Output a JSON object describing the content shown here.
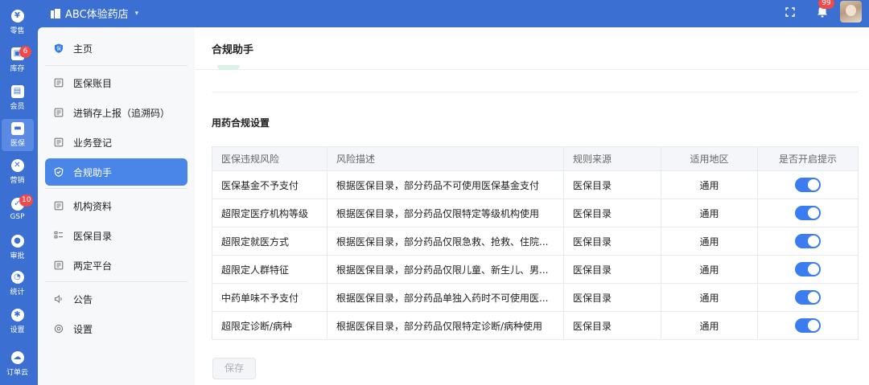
{
  "rail": {
    "items": [
      {
        "label": "零售",
        "glyph": "¥",
        "icon": "yen-icon"
      },
      {
        "label": "库存",
        "glyph": "▣",
        "icon": "inventory-icon",
        "badge": "6"
      },
      {
        "label": "会员",
        "glyph": "▤",
        "icon": "member-card-icon"
      },
      {
        "label": "医保",
        "glyph": "▬",
        "icon": "medical-insurance-icon"
      },
      {
        "label": "营销",
        "glyph": "✕",
        "icon": "marketing-icon"
      },
      {
        "label": "GSP",
        "glyph": "✓",
        "icon": "gsp-shield-icon",
        "badge": "10"
      },
      {
        "label": "审批",
        "glyph": "●",
        "icon": "approval-user-icon"
      },
      {
        "label": "统计",
        "glyph": "◔",
        "icon": "stats-pie-icon"
      },
      {
        "label": "设置",
        "glyph": "✱",
        "icon": "settings-gear-icon"
      },
      {
        "label": "订单云",
        "glyph": "☁",
        "icon": "order-cloud-icon"
      }
    ],
    "active_index": 3
  },
  "topbar": {
    "store_name": "ABC体验药店",
    "notification_badge": "99"
  },
  "sidebar": {
    "items": [
      {
        "label": "主页",
        "icon": "insurance-badge-icon"
      },
      {
        "label": "医保账目",
        "icon": "ledger-icon"
      },
      {
        "label": "进销存上报（追溯码）",
        "icon": "report-doc-icon"
      },
      {
        "label": "业务登记",
        "icon": "register-icon"
      },
      {
        "label": "合规助手",
        "icon": "shield-check-icon"
      },
      {
        "label": "机构资料",
        "icon": "institution-doc-icon"
      },
      {
        "label": "医保目录",
        "icon": "catalog-list-icon"
      },
      {
        "label": "两定平台",
        "icon": "platform-icon"
      },
      {
        "label": "公告",
        "icon": "speaker-icon"
      },
      {
        "label": "设置",
        "icon": "gear-icon"
      }
    ],
    "active_index": 4
  },
  "main": {
    "title": "合规助手",
    "section_title": "用药合规设置",
    "columns": [
      "医保违规风险",
      "风险描述",
      "规则来源",
      "适用地区",
      "是否开启提示"
    ],
    "rows": [
      {
        "risk": "医保基金不予支付",
        "desc": "根据医保目录，部分药品不可使用医保基金支付",
        "source": "医保目录",
        "region": "通用",
        "enabled": true
      },
      {
        "risk": "超限定医疗机构等级",
        "desc": "根据医保目录，部分药品仅限特定等级机构使用",
        "source": "医保目录",
        "region": "通用",
        "enabled": true
      },
      {
        "risk": "超限定就医方式",
        "desc": "根据医保目录，部分药品仅限急救、抢救、住院...",
        "source": "医保目录",
        "region": "通用",
        "enabled": true
      },
      {
        "risk": "超限定人群特征",
        "desc": "根据医保目录，部分药品仅限儿童、新生儿、男...",
        "source": "医保目录",
        "region": "通用",
        "enabled": true
      },
      {
        "risk": "中药单味不予支付",
        "desc": "根据医保目录，部分药品单独入药时不可使用医...",
        "source": "医保目录",
        "region": "通用",
        "enabled": true
      },
      {
        "risk": "超限定诊断/病种",
        "desc": "根据医保目录，部分药品仅限特定诊断/病种使用",
        "source": "医保目录",
        "region": "通用",
        "enabled": true
      }
    ],
    "save_label": "保存"
  },
  "colors": {
    "brand": "#3b6fd1",
    "active_nav": "#4a86e8",
    "toggle_on": "#3b7cf0",
    "badge": "#f04a4a"
  }
}
